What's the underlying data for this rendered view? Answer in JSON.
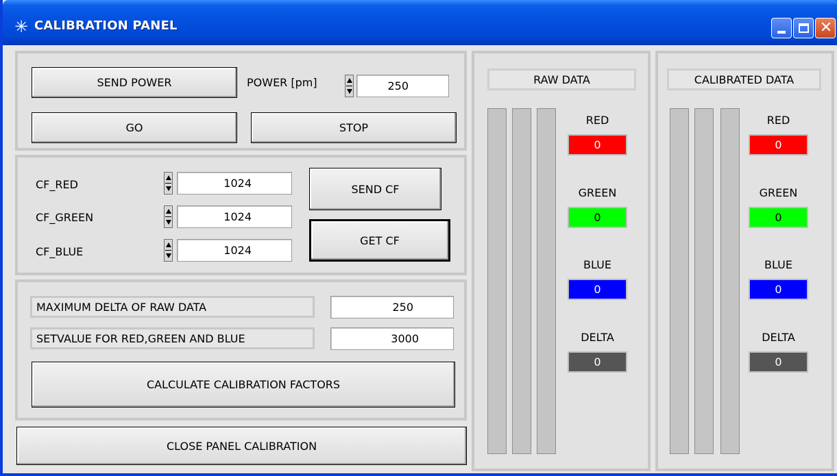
{
  "window": {
    "title": "CALIBRATION PANEL",
    "title_icon": "sparkle-icon",
    "controls": [
      "minimize-icon",
      "maximize-icon",
      "close-icon"
    ]
  },
  "power_panel": {
    "send_power_label": "SEND POWER",
    "power_label": "POWER [pm]",
    "power_value": "250",
    "go_label": "GO",
    "stop_label": "STOP"
  },
  "cf_panel": {
    "red_label": "CF_RED",
    "red_value": "1024",
    "green_label": "CF_GREEN",
    "green_value": "1024",
    "blue_label": "CF_BLUE",
    "blue_value": "1024",
    "send_cf_label": "SEND CF",
    "get_cf_label": "GET CF"
  },
  "calc_panel": {
    "max_delta_label": "MAXIMUM DELTA OF RAW DATA",
    "max_delta_value": "250",
    "setvalue_label": "SETVALUE FOR RED,GREEN AND BLUE",
    "setvalue_value": "3000",
    "calculate_label": "CALCULATE CALIBRATION FACTORS"
  },
  "close_label": "CLOSE PANEL CALIBRATION",
  "raw_data": {
    "title": "RAW DATA",
    "red_label": "RED",
    "red_value": "0",
    "green_label": "GREEN",
    "green_value": "0",
    "blue_label": "BLUE",
    "blue_value": "0",
    "delta_label": "DELTA",
    "delta_value": "0"
  },
  "calibrated_data": {
    "title": "CALIBRATED DATA",
    "red_label": "RED",
    "red_value": "0",
    "green_label": "GREEN",
    "green_value": "0",
    "blue_label": "BLUE",
    "blue_value": "0",
    "delta_label": "DELTA",
    "delta_value": "0"
  },
  "colors": {
    "red": "#FF0000",
    "green": "#00FF00",
    "blue": "#0000FF",
    "delta": "#555555",
    "titlebar": "#0A5FE8"
  }
}
